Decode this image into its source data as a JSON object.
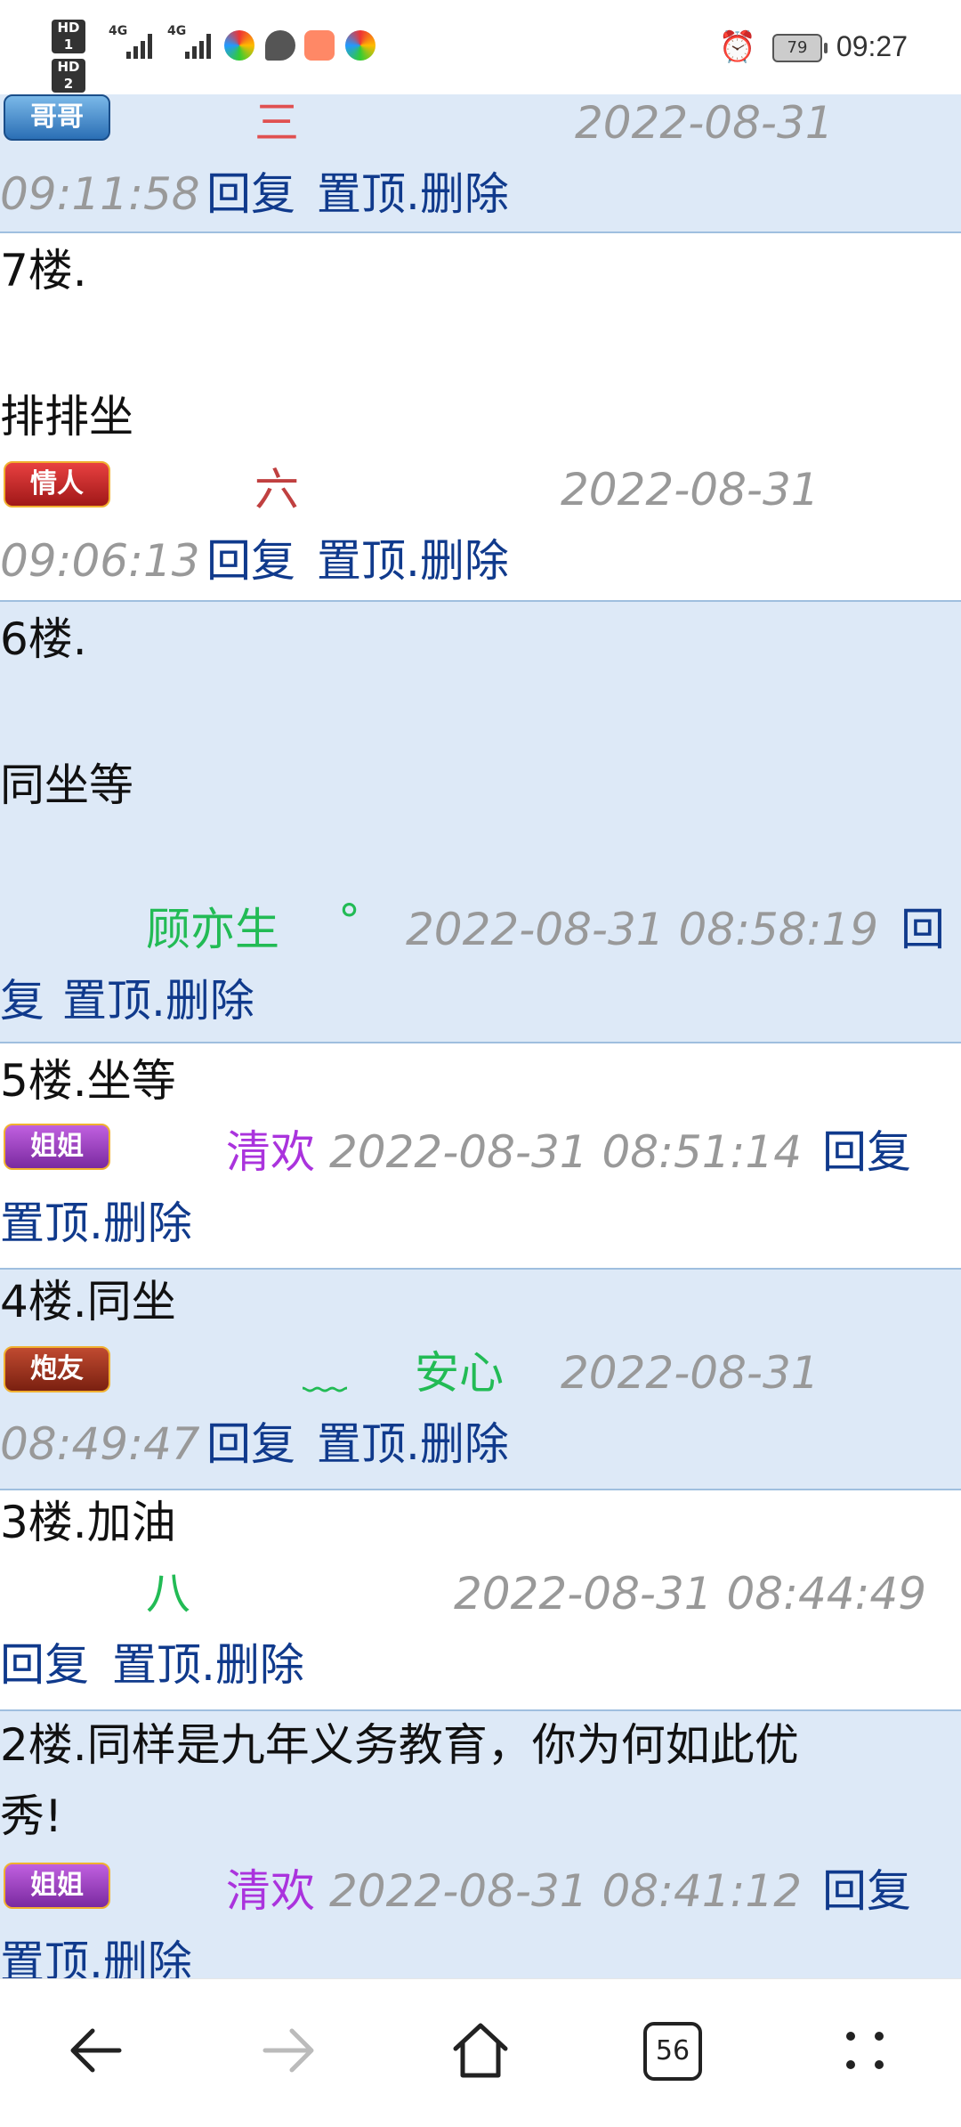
{
  "status_bar": {
    "sim1": "HD 1",
    "sim2": "HD 2",
    "signal1": "4G",
    "signal2": "4G",
    "battery": "79",
    "time": "09:27",
    "icons": [
      "app-icon-colorful",
      "message-icon",
      "health-app-icon",
      "app-icon-colorful"
    ]
  },
  "posts": [
    {
      "badge": "哥哥",
      "author": "三",
      "timestamp_part1": "2022-08-31",
      "timestamp_part2": "09:11:58",
      "reply": "回复",
      "actions": "置顶.删除"
    },
    {
      "floor_label": "7楼.",
      "content": "排排坐",
      "badge": "情人",
      "author": "六",
      "timestamp_part1": "2022-08-31",
      "timestamp_part2": "09:06:13",
      "reply": "回复",
      "actions": "置顶.删除"
    },
    {
      "floor_label": "6楼.",
      "content": "同坐等",
      "author": "顾亦生",
      "author_suffix": "°",
      "timestamp": "2022-08-31 08:58:19",
      "reply_part1": "回",
      "reply_part2": "复",
      "actions": "置顶.删除"
    },
    {
      "floor_label": "5楼.坐等",
      "badge": "姐姐",
      "author": "清欢",
      "timestamp": "2022-08-31 08:51:14",
      "reply": "回复",
      "actions": "置顶.删除"
    },
    {
      "floor_label": "4楼.同坐",
      "badge": "炮友",
      "author_prefix": "﹏",
      "author": "安心",
      "timestamp_part1": "2022-08-31",
      "timestamp_part2": "08:49:47",
      "reply": "回复",
      "actions": "置顶.删除"
    },
    {
      "floor_label": "3楼.加油",
      "author": "八",
      "timestamp": "2022-08-31 08:44:49",
      "reply": "回复",
      "actions": "置顶.删除"
    },
    {
      "floor_label_line1": "2楼.同样是九年义务教育，你为何如此优",
      "floor_label_line2": "秀!",
      "badge": "姐姐",
      "author": "清欢",
      "timestamp": "2022-08-31 08:41:12",
      "reply": "回复",
      "actions": "置顶.删除"
    }
  ],
  "nav": {
    "back": "back-arrow-icon",
    "forward": "forward-arrow-icon",
    "home": "home-icon",
    "tabs_count": "56",
    "menu": "menu-dots-icon"
  },
  "colors": {
    "link": "#103a8c",
    "timestamp": "#999999",
    "row_blue": "#dde9f7",
    "author_green": "#22bb55",
    "author_purple": "#aa33dd"
  }
}
